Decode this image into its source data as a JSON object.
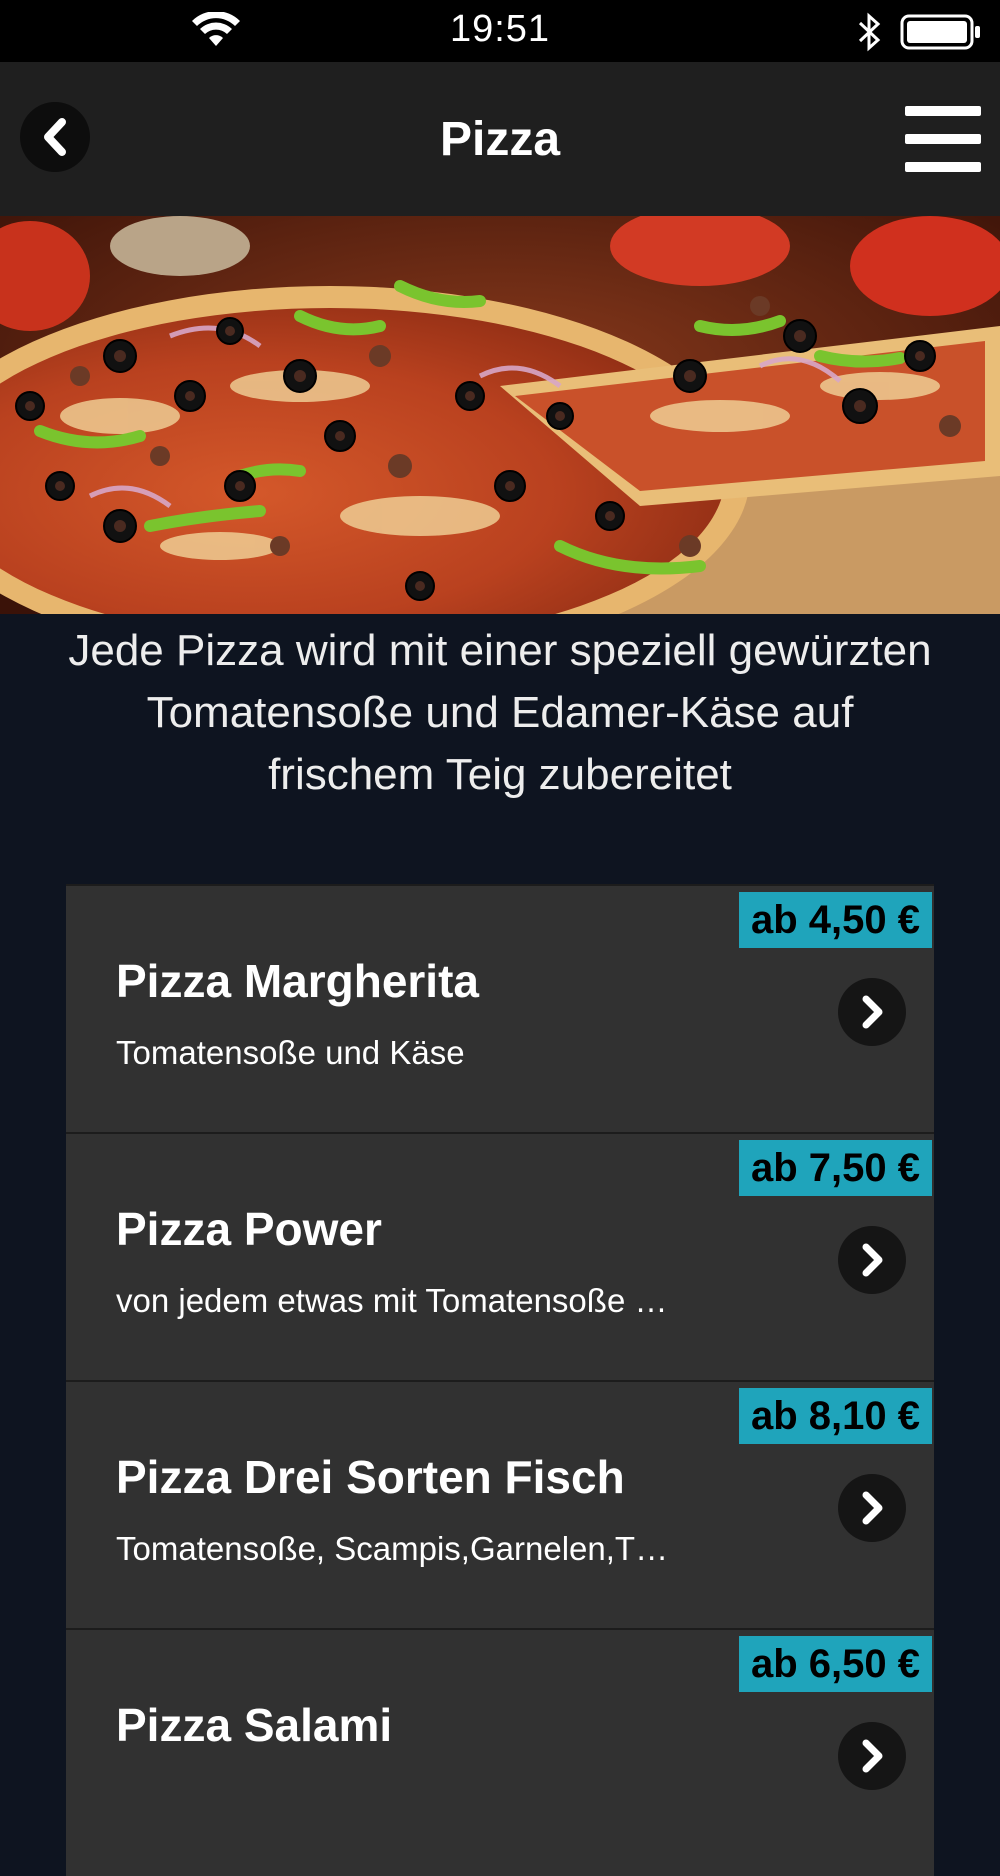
{
  "status_bar": {
    "time": "19:51",
    "icons": [
      "wifi-icon",
      "bluetooth-icon",
      "battery-icon"
    ]
  },
  "nav": {
    "title": "Pizza",
    "back_icon": "chevron-left-icon",
    "menu_icon": "hamburger-menu-icon"
  },
  "hero": {
    "description": "pizza photo banner"
  },
  "intro": {
    "lines": [
      "Jede Pizza wird mit einer speziell gewürzten",
      "Tomatensoße und Edamer-Käse auf",
      "frischem Teig zubereitet"
    ]
  },
  "menu": {
    "items": [
      {
        "name": "Pizza Margherita",
        "description": "Tomatensoße und Käse",
        "price": "ab 4,50 €"
      },
      {
        "name": "Pizza Power",
        "description": "von jedem etwas mit Tomatensoße und…",
        "price": "ab 7,50 €"
      },
      {
        "name": "Pizza Drei Sorten Fisch",
        "description": "Tomatensoße, Scampis,Garnelen,Thun…",
        "price": "ab 8,10 €"
      },
      {
        "name": "Pizza Salami",
        "description": "",
        "price": "ab 6,50 €"
      }
    ]
  },
  "colors": {
    "price_badge": "#1fa4bb",
    "background": "#0e1420",
    "item_background": "#313131",
    "nav_background": "#1f1f1f"
  }
}
